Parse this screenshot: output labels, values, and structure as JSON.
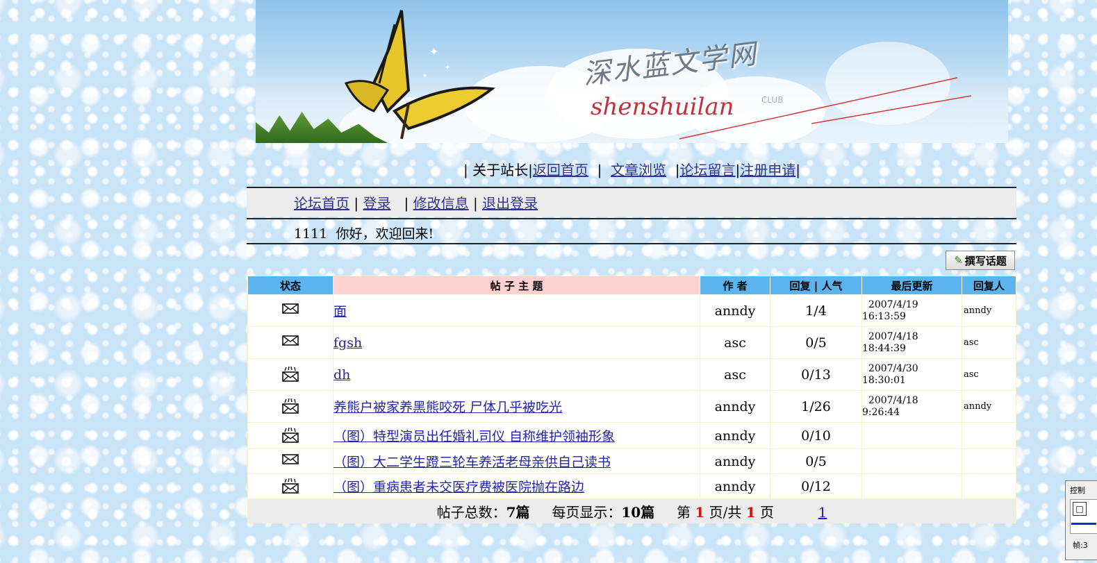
{
  "banner": {
    "title_cn": "深水蓝文学网",
    "title_en": "shenshuilan",
    "subtitle": "CLUB"
  },
  "top_nav": {
    "about": "关于站长",
    "home": "返回首页",
    "articles": "文章浏览",
    "forum_msg": "论坛留言",
    "register": "注册申请"
  },
  "forum_nav": {
    "forum_home": "论坛首页",
    "login": "登录",
    "edit_info": "修改信息",
    "logout": "退出登录"
  },
  "welcome": {
    "user": "1111",
    "message": "你好，欢迎回来!"
  },
  "new_topic_button": "撰写话题",
  "table": {
    "headers": {
      "status": "状态",
      "subject": "帖 子 主 题",
      "author": "作 者",
      "replies": "回复 | 人气",
      "last_update": "最后更新",
      "replier": "回复人"
    },
    "rows": [
      {
        "icon": "envelope-icon",
        "title": "面",
        "author": "anndy",
        "stats": "1/4",
        "date": "2007/4/19",
        "time": "16:13:59",
        "replier": "anndy"
      },
      {
        "icon": "envelope-icon",
        "title": "fgsh",
        "author": "asc",
        "stats": "0/5",
        "date": "2007/4/18",
        "time": "18:44:39",
        "replier": "asc"
      },
      {
        "icon": "hot-envelope-icon",
        "title": "dh",
        "author": "asc",
        "stats": "0/13",
        "date": "2007/4/30",
        "time": "18:30:01",
        "replier": "asc"
      },
      {
        "icon": "hot-envelope-icon",
        "title": "养熊户被家养黑熊咬死 尸体几乎被吃光",
        "author": "anndy",
        "stats": "1/26",
        "date": "2007/4/18",
        "time": "9:26:44",
        "replier": "anndy"
      },
      {
        "icon": "hot-envelope-icon",
        "title": "（图）特型演员出任婚礼司仪 自称维护领袖形象",
        "author": "anndy",
        "stats": "0/10",
        "date": "",
        "time": "",
        "replier": ""
      },
      {
        "icon": "envelope-icon",
        "title": "（图）大二学生蹬三轮车养活老母亲供自己读书",
        "author": "anndy",
        "stats": "0/5",
        "date": "",
        "time": "",
        "replier": ""
      },
      {
        "icon": "hot-envelope-icon",
        "title": "（图）重病患者未交医疗费被医院抛在路边",
        "author": "anndy",
        "stats": "0/12",
        "date": "",
        "time": "",
        "replier": ""
      }
    ]
  },
  "footer": {
    "total_label": "帖子总数：",
    "total_value": "7篇",
    "per_page_label": "每页显示：",
    "per_page_value": "10篇",
    "page_prefix": "第",
    "current_page": "1",
    "page_mid": "页/共",
    "total_pages": "1",
    "page_suffix": "页",
    "page_link": "1"
  },
  "side_panel": {
    "title": "控制",
    "button": "□",
    "frame_label": "帧:3"
  },
  "colors": {
    "header_blue": "#5bb4ee",
    "header_pink": "#ffd0d0",
    "link": "#33338a",
    "page_red": "#d41010"
  }
}
